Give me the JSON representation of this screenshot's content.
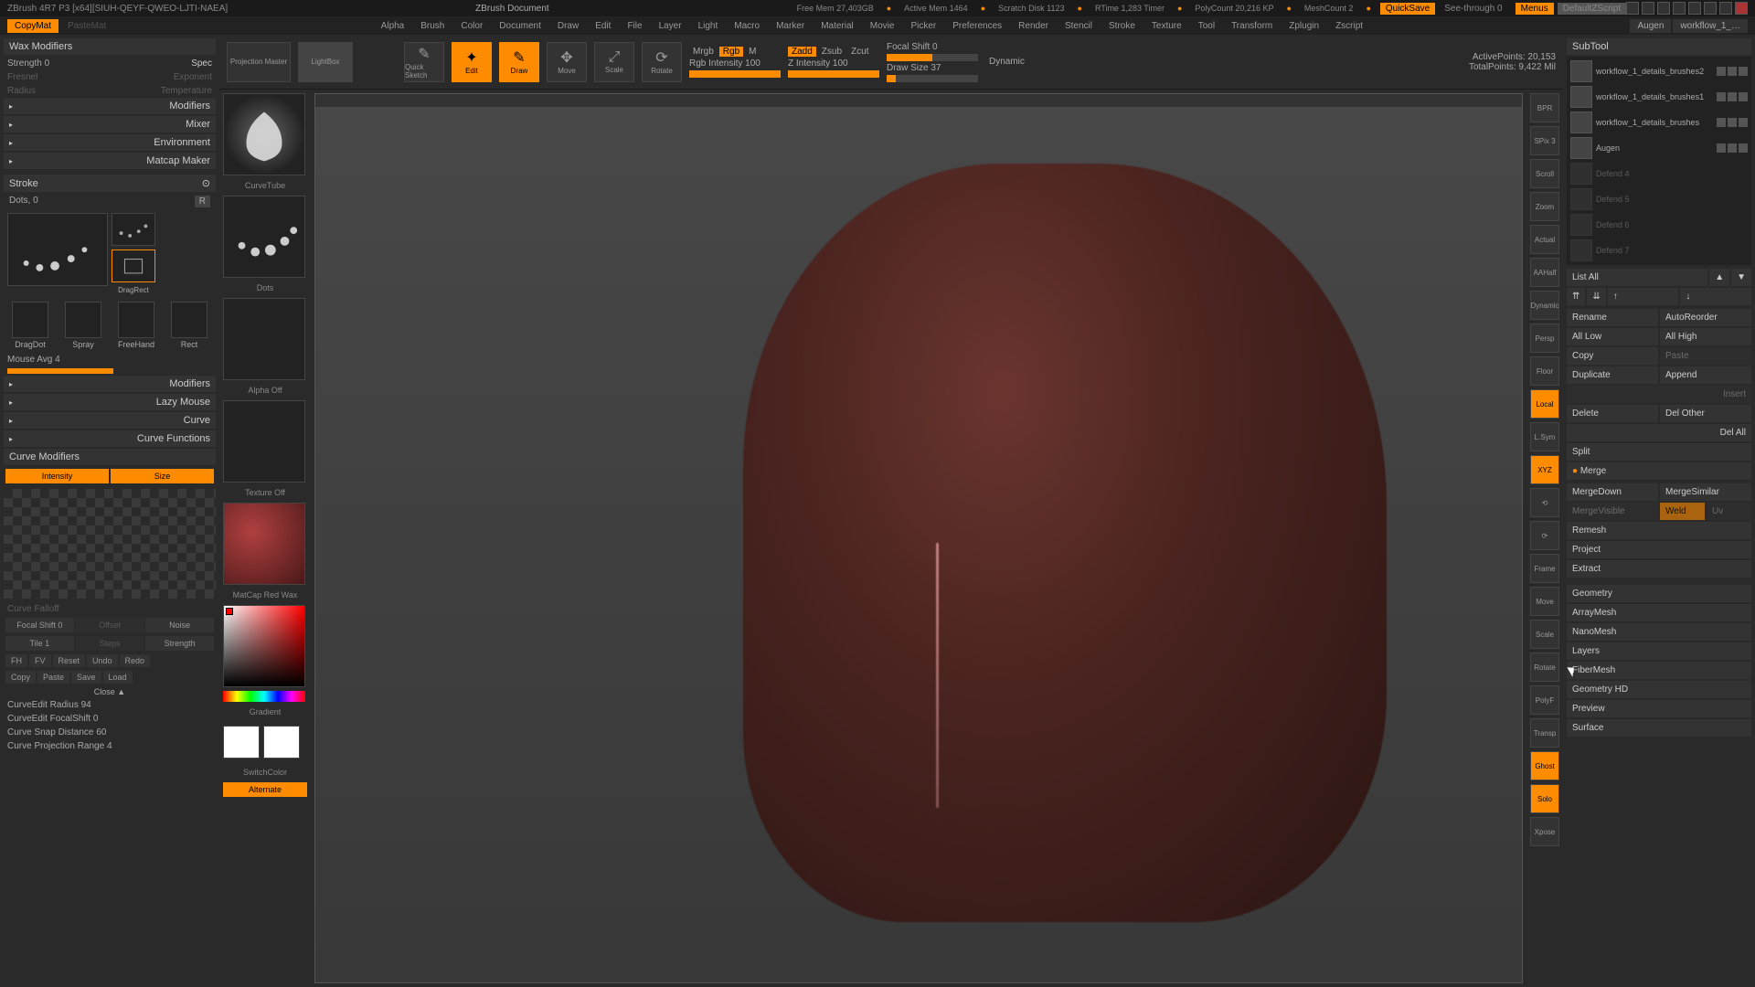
{
  "title": {
    "app": "ZBrush 4R7 P3 [x64][SIUH-QEYF-QWEO-LJTI-NAEA]",
    "doc": "ZBrush Document",
    "freemem": "Free Mem 27,403GB",
    "activemem": "Active Mem 1464",
    "scratch": "Scratch Disk 1123",
    "rtime": "RTime 1,283 Timer",
    "polycount": "PolyCount 20,216 KP",
    "meshcount": "MeshCount 2",
    "quicksave": "QuickSave",
    "seethrough": "See-through   0",
    "menus": "Menus",
    "script": "DefaultZScript"
  },
  "menu": {
    "copymat": "CopyMat",
    "pastemat": "PasteMat",
    "items": [
      "Alpha",
      "Brush",
      "Color",
      "Document",
      "Draw",
      "Edit",
      "File",
      "Layer",
      "Light",
      "Macro",
      "Marker",
      "Material",
      "Movie",
      "Picker",
      "Preferences",
      "Render",
      "Stencil",
      "Stroke",
      "Texture",
      "Tool",
      "Transform",
      "Zplugin",
      "Zscript"
    ]
  },
  "left": {
    "wax": "Wax Modifiers",
    "strength": "Strength 0",
    "spec": "Spec",
    "fresnel": "Fresnel",
    "exponent": "Exponent",
    "radius": "Radius",
    "temperature": "Temperature",
    "modifiers": "Modifiers",
    "mixer": "Mixer",
    "environment": "Environment",
    "matcap": "Matcap Maker",
    "stroke": "Stroke",
    "dots": "Dots, 0",
    "r": "R",
    "dragdot": "DragDot",
    "spray": "Spray",
    "freehand": "FreeHand",
    "rect": "Rect",
    "dragrect": "DragRect",
    "mouseavg": "Mouse Avg 4",
    "modifiers2": "Modifiers",
    "lazymouse": "Lazy Mouse",
    "curve": "Curve",
    "curvefunc": "Curve Functions",
    "curvemod": "Curve Modifiers",
    "intensity": "Intensity",
    "size": "Size",
    "falloff": "Curve Falloff",
    "focalshift": "Focal Shift 0",
    "offset": "Offset",
    "noise": "Noise",
    "tile": "Tile 1",
    "steps": "Steps",
    "strength2": "Strength",
    "fh": "FH",
    "fv": "FV",
    "reset": "Reset",
    "undo": "Undo",
    "redo": "Redo",
    "copy": "Copy",
    "paste": "Paste",
    "save": "Save",
    "load": "Load",
    "close": "Close ▲",
    "radius2": "CurveEdit Radius 94",
    "focal2": "CurveEdit FocalShift 0",
    "snap": "Curve Snap Distance 60",
    "proj": "Curve Projection Range 4"
  },
  "toolbar": {
    "projmaster": "Projection Master",
    "lightbox": "LightBox",
    "quicksketch": "Quick Sketch",
    "edit": "Edit",
    "draw": "Draw",
    "move": "Move",
    "scale": "Scale",
    "rotate": "Rotate",
    "mrgb": "Mrgb",
    "rgb": "Rgb",
    "m": "M",
    "rgbint": "Rgb Intensity 100",
    "zadd": "Zadd",
    "zsub": "Zsub",
    "zcut": "Zcut",
    "zint": "Z Intensity 100",
    "focalshift": "Focal Shift 0",
    "drawsize": "Draw Size 37",
    "dynamic": "Dynamic",
    "active": "ActivePoints: 20,153",
    "total": "TotalPoints: 9,422 Mil"
  },
  "shelf": {
    "curvetube": "CurveTube",
    "dots": "Dots",
    "alphaoff": "Alpha Off",
    "textureoff": "Texture Off",
    "matcap": "MatCap Red Wax",
    "gradient": "Gradient",
    "switchcolor": "SwitchColor",
    "alternate": "Alternate"
  },
  "nav": {
    "bpr": "BPR",
    "spix": "SPix 3",
    "scroll": "Scroll",
    "zoom": "Zoom",
    "actual": "Actual",
    "aahalf": "AAHalf",
    "dynamic": "Dynamic",
    "persp": "Persp",
    "floor": "Floor",
    "local": "Local",
    "lsym": "L.Sym",
    "xyz": "XYZ",
    "frame": "Frame",
    "move": "Move",
    "scale": "Scale",
    "rotate": "Rotate",
    "polyf": "PolyF",
    "transp": "Transp",
    "ghost": "Ghost",
    "solo": "Solo",
    "xpose": "Xpose"
  },
  "right": {
    "subtool": "SubTool",
    "augen_top": "Augen",
    "workflow_top": "workflow_1_…",
    "items": [
      {
        "name": "workflow_1_details_brushes2"
      },
      {
        "name": "workflow_1_details_brushes1"
      },
      {
        "name": "workflow_1_details_brushes"
      },
      {
        "name": "Augen"
      },
      {
        "name": "Defend 4"
      },
      {
        "name": "Defend 5"
      },
      {
        "name": "Defend 6"
      },
      {
        "name": "Defend 7"
      }
    ],
    "listall": "List All",
    "rename": "Rename",
    "autoreorder": "AutoReorder",
    "alllow": "All Low",
    "allhigh": "All High",
    "copy": "Copy",
    "paste": "Paste",
    "duplicate": "Duplicate",
    "append": "Append",
    "insert": "Insert",
    "delete": "Delete",
    "delother": "Del Other",
    "delall": "Del All",
    "split": "Split",
    "merge": "Merge",
    "mergedown": "MergeDown",
    "mergesimilar": "MergeSimilar",
    "mergevisible": "MergeVisible",
    "weld": "Weld",
    "uv": "Uv",
    "remesh": "Remesh",
    "project": "Project",
    "extract": "Extract",
    "geometry": "Geometry",
    "arraymesh": "ArrayMesh",
    "nanomesh": "NanoMesh",
    "layers": "Layers",
    "fibermesh": "FiberMesh",
    "geometryhd": "Geometry HD",
    "preview": "Preview",
    "surface": "Surface"
  }
}
